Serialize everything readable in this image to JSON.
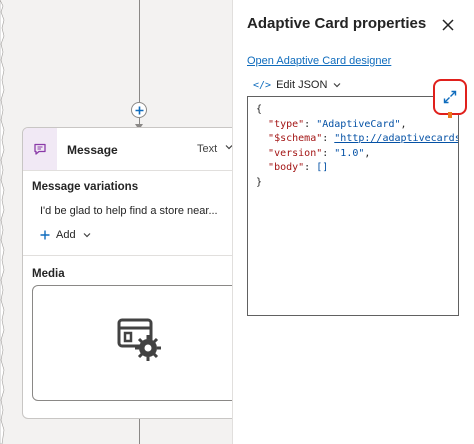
{
  "canvas": {
    "message_node": {
      "title": "Message",
      "type_label": "Text",
      "variations_label": "Message variations",
      "variation_text": "I'd be glad to help find a store near...",
      "add_label": "Add",
      "media_label": "Media"
    }
  },
  "panel": {
    "title": "Adaptive Card properties",
    "designer_link": "Open Adaptive Card designer",
    "edit_json_label": "Edit JSON",
    "json": {
      "open_brace": "{",
      "type_key": "\"type\"",
      "type_value": "\"AdaptiveCard\"",
      "schema_key": "\"$schema\"",
      "schema_value": "\"http://adaptivecards.i",
      "version_key": "\"version\"",
      "version_value": "\"1.0\"",
      "body_key": "\"body\"",
      "body_value": "[]",
      "close_brace": "}"
    }
  },
  "colors": {
    "accent": "#0f6cbd",
    "highlight": "#e0201c",
    "canvas_bg": "#f3f2f1",
    "message_icon_bg": "#f1e9f5"
  }
}
